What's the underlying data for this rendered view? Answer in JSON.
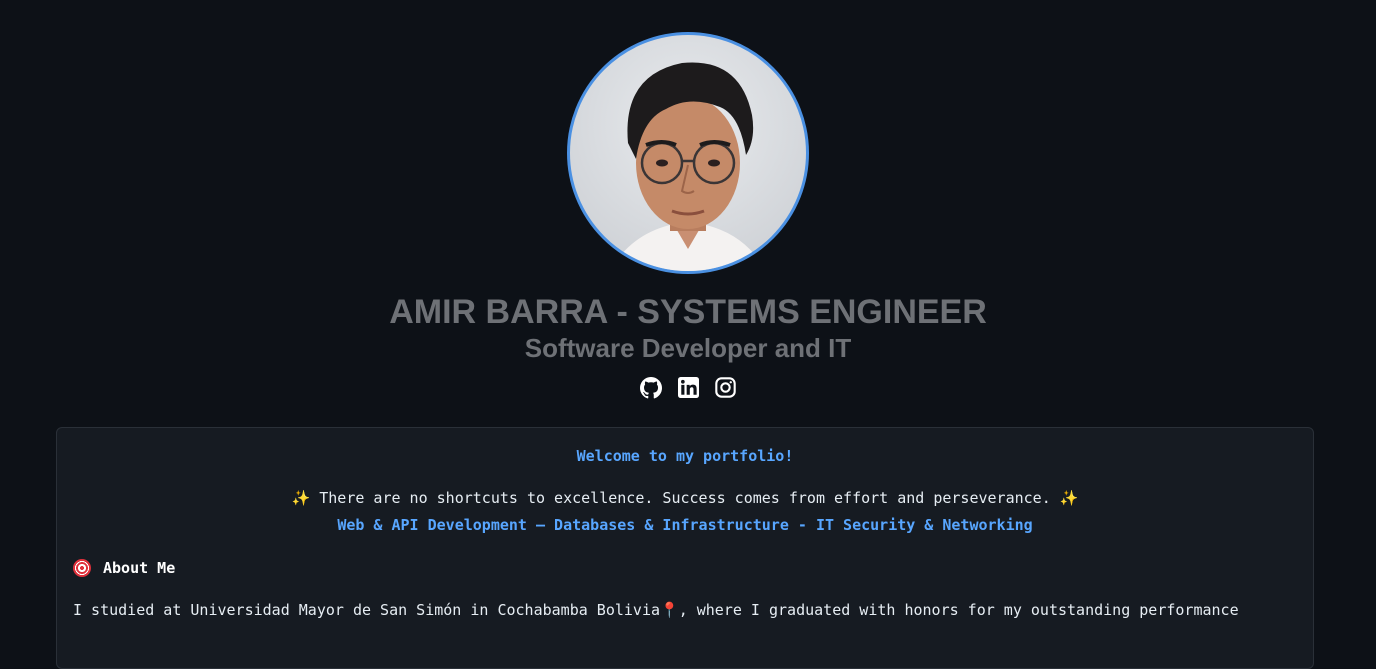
{
  "profile": {
    "name": "AMIR BARRA - SYSTEMS ENGINEER",
    "subtitle": "Software Developer and IT"
  },
  "socials": [
    {
      "name": "github-icon"
    },
    {
      "name": "linkedin-icon"
    },
    {
      "name": "instagram-icon"
    }
  ],
  "card": {
    "welcome": "Welcome to my portfolio!",
    "quote": "There are no shortcuts to excellence. Success comes from effort and perseverance.",
    "sparkle": "✨",
    "skills": "Web & API Development – Databases & Infrastructure - IT Security & Networking",
    "about_heading": "About Me",
    "about_text_before_pin": "I studied at Universidad Mayor de San Simón in Cochabamba Bolivia",
    "pin": "📍",
    "about_text_after_pin": ", where I graduated with honors for my outstanding performance"
  },
  "colors": {
    "background": "#0d1117",
    "card": "#161b22",
    "accent": "#58a6ff",
    "avatar_border": "#4a90e2",
    "heading_gray": "#6e7176"
  }
}
